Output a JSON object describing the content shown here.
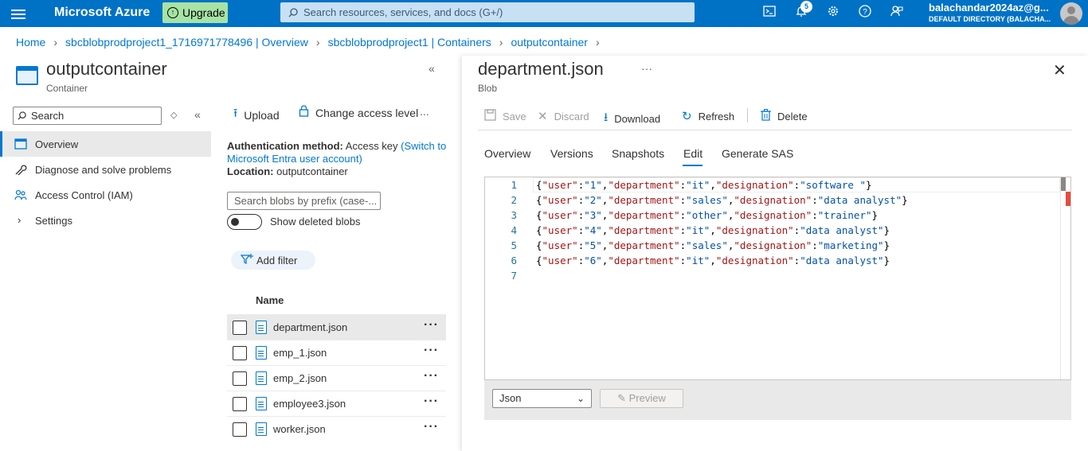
{
  "topbar": {
    "brand": "Microsoft Azure",
    "upgrade_label": "Upgrade",
    "search_placeholder": "Search resources, services, and docs (G+/)",
    "notifications_count": "5",
    "user_name": "balachandar2024az@g...",
    "user_directory": "DEFAULT DIRECTORY (BALACHA...",
    "icons": [
      "menu-icon",
      "cloud-shell-icon",
      "bell-icon",
      "gear-icon",
      "help-icon",
      "feedback-icon"
    ]
  },
  "breadcrumb": [
    "Home",
    "sbcblobprodproject1_1716971778496 | Overview",
    "sbcblobprodproject1 | Containers",
    "outputcontainer"
  ],
  "left": {
    "title": "outputcontainer",
    "subtitle": "Container",
    "search_label": "Search",
    "nav": [
      {
        "label": "Overview",
        "icon": "overview-icon",
        "selected": true
      },
      {
        "label": "Diagnose and solve problems",
        "icon": "wrench-icon",
        "selected": false
      },
      {
        "label": "Access Control (IAM)",
        "icon": "people-icon",
        "selected": false
      },
      {
        "label": "Settings",
        "icon": "chevron-right-icon",
        "selected": false
      }
    ],
    "toolbar": {
      "upload": "Upload",
      "change_access": "Change access level",
      "more": "..."
    },
    "auth_label": "Authentication method:",
    "auth_value": "Access key",
    "auth_link": "(Switch to Microsoft Entra user account)",
    "location_label": "Location:",
    "location_value": "outputcontainer",
    "blob_search_placeholder": "Search blobs by prefix (case-...",
    "show_deleted": "Show deleted blobs",
    "add_filter": "Add filter",
    "name_header": "Name",
    "blobs": [
      {
        "name": "department.json",
        "selected": true
      },
      {
        "name": "emp_1.json",
        "selected": false
      },
      {
        "name": "emp_2.json",
        "selected": false
      },
      {
        "name": "employee3.json",
        "selected": false
      },
      {
        "name": "worker.json",
        "selected": false
      }
    ]
  },
  "right": {
    "title": "department.json",
    "subtitle": "Blob",
    "toolbar": {
      "save": "Save",
      "discard": "Discard",
      "download": "Download",
      "refresh": "Refresh",
      "delete": "Delete"
    },
    "tabs": [
      "Overview",
      "Versions",
      "Snapshots",
      "Edit",
      "Generate SAS"
    ],
    "active_tab": "Edit",
    "editor_lines": [
      "{\"user\":\"1\",\"department\":\"it\",\"designation\":\"software \"}",
      "{\"user\":\"2\",\"department\":\"sales\",\"designation\":\"data analyst\"}",
      "{\"user\":\"3\",\"department\":\"other\",\"designation\":\"trainer\"}",
      "{\"user\":\"4\",\"department\":\"it\",\"designation\":\"data analyst\"}",
      "{\"user\":\"5\",\"department\":\"sales\",\"designation\":\"marketing\"}",
      "{\"user\":\"6\",\"department\":\"it\",\"designation\":\"data analyst\"}",
      ""
    ],
    "format_select": "Json",
    "preview_label": "Preview"
  }
}
